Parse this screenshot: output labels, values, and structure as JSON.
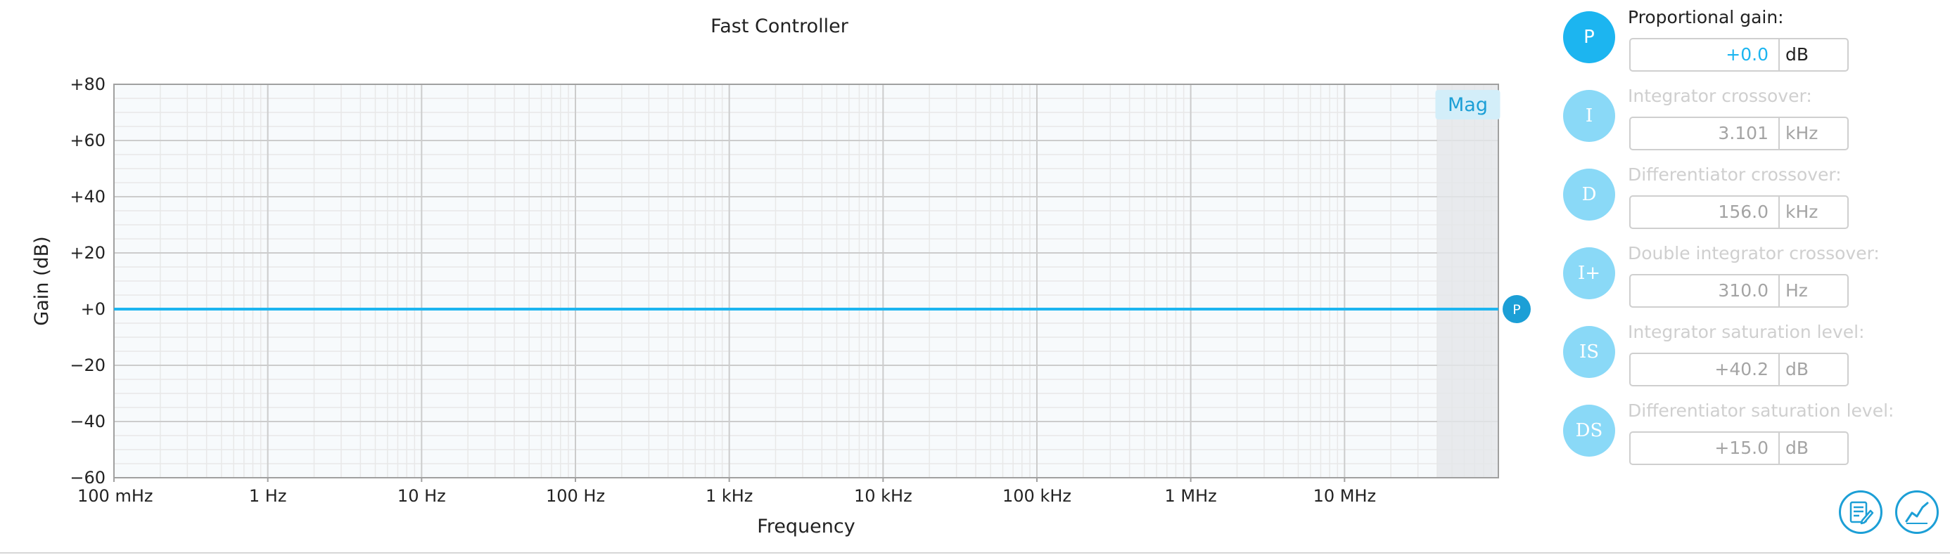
{
  "chart_data": {
    "type": "line",
    "title": "Fast Controller",
    "xlabel": "Frequency",
    "ylabel": "Gain (dB)",
    "x_scale": "log",
    "xlim": [
      0.1,
      100000000
    ],
    "ylim": [
      -60,
      80
    ],
    "x_tick_values": [
      0.1,
      1,
      10,
      100,
      1000,
      10000,
      100000,
      1000000,
      10000000
    ],
    "x_tick_labels": [
      "100 mHz",
      "1 Hz",
      "10 Hz",
      "100 Hz",
      "1 kHz",
      "10 kHz",
      "100 kHz",
      "1 MHz",
      "10 MHz"
    ],
    "y_tick_values": [
      80,
      60,
      40,
      20,
      0,
      -20,
      -40,
      -60
    ],
    "y_tick_labels": [
      "+80",
      "+60",
      "+40",
      "+20",
      "+0",
      "−20",
      "−40",
      "−60"
    ],
    "grid": true,
    "shaded_region_x": [
      40000000,
      100000000
    ],
    "shaded_region_label": "Mag",
    "series": [
      {
        "x": [
          0.1,
          100000000
        ],
        "y": [
          0,
          0
        ],
        "color": "#1cb5f0"
      }
    ],
    "marker": {
      "label": "P",
      "y": 0,
      "color": "#1c9fd6"
    }
  },
  "controller_terms": [
    {
      "symbol": "P",
      "label": "Proportional gain:",
      "value": "+0.0",
      "unit": "dB",
      "active": true
    },
    {
      "symbol": "I",
      "label": "Integrator crossover:",
      "value": "3.101",
      "unit": "kHz",
      "active": false
    },
    {
      "symbol": "D",
      "label": "Differentiator crossover:",
      "value": "156.0",
      "unit": "kHz",
      "active": false
    },
    {
      "symbol": "I+",
      "label": "Double integrator crossover:",
      "value": "310.0",
      "unit": "Hz",
      "active": false
    },
    {
      "symbol": "IS",
      "label": "Integrator saturation level:",
      "value": "+40.2",
      "unit": "dB",
      "active": false
    },
    {
      "symbol": "DS",
      "label": "Differentiator saturation level:",
      "value": "+15.0",
      "unit": "dB",
      "active": false
    }
  ],
  "tools": [
    {
      "icon": "edit-notes-icon"
    },
    {
      "icon": "chart-trend-icon"
    }
  ],
  "colors": {
    "accent": "#1cb5f0",
    "accent_dark": "#1c9fd6",
    "inactive_button": "#8ad9f7",
    "grid_major": "#cccccc",
    "grid_minor": "#e8e8e8",
    "plot_background": "#f7fafc",
    "shaded_region": "#e4e6e8"
  }
}
